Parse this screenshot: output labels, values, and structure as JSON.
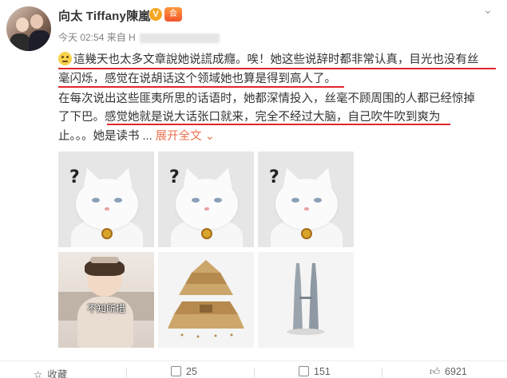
{
  "post": {
    "username": "向太 Tiffany陳嵐",
    "verified_badge": "V",
    "vip_badge": "会",
    "time": "今天 02:54",
    "from_label": "来自 H",
    "text_lines": [
      "這幾天也太多文章說她说謊成癮。唉！她这些说辞时都非常认真，目光也没有丝",
      "毫闪烁，感觉在说胡话这个领域她也算是得到高人了。",
      "在每次说出这些匪夷所思的话语时，她都深情投入，丝毫不顾周围的人都已经惊掉",
      "了下巴。感觉她就是说大话张口就来，完全不经过大脑，自己吹牛吹到爽为",
      "止。。。她是读书 ..."
    ],
    "expand_label": "展开全文",
    "expand_icon": "chevron-down-icon",
    "image_caption": "不知所措",
    "underline_color": "#e0252a",
    "link_color": "#eb7350"
  },
  "images": [
    {
      "kind": "cat",
      "label": "?"
    },
    {
      "kind": "cat",
      "label": "?"
    },
    {
      "kind": "cat",
      "label": "?"
    },
    {
      "kind": "girl"
    },
    {
      "kind": "pyramid"
    },
    {
      "kind": "towers"
    }
  ],
  "footer": {
    "favorite_label": "收藏",
    "repost_count": "25",
    "comment_count": "151",
    "like_count": "6921",
    "favorite_icon": "star-icon",
    "repost_icon": "repost-icon",
    "comment_icon": "comment-icon",
    "like_icon": "thumbs-up-icon"
  }
}
